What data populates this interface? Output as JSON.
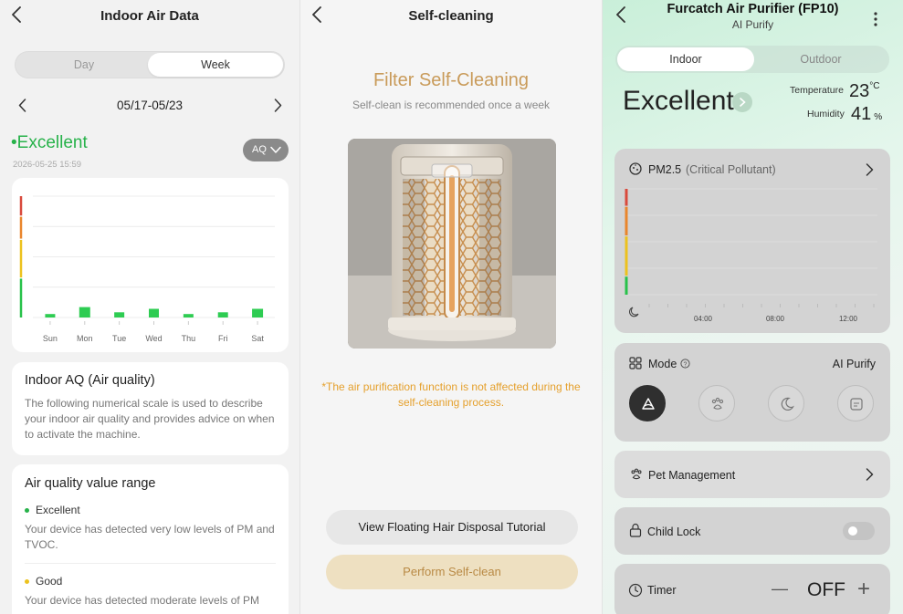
{
  "panel1": {
    "title": "Indoor Air Data",
    "tabs": [
      "Day",
      "Week"
    ],
    "active_tab": "Week",
    "date_range": "05/17-05/23",
    "status": "•Excellent",
    "timestamp": "2026-05-25 15:59",
    "aq_button": "AQ",
    "chart_data": {
      "type": "bar",
      "categories": [
        "Sun",
        "Mon",
        "Tue",
        "Wed",
        "Thu",
        "Fri",
        "Sat"
      ],
      "values": [
        1,
        3,
        1.5,
        2.5,
        1,
        1.5,
        2.5
      ],
      "ylim": [
        0,
        35
      ],
      "grid": true,
      "bar_color": "#2ecc52",
      "level_colors": [
        "#27c24a",
        "#ecc21e",
        "#e9862c",
        "#d94a3c"
      ]
    },
    "info_card": {
      "title": "Indoor AQ (Air quality)",
      "body": "The following numerical scale is used to describe your indoor air quality and provides advice on when to activate the machine."
    },
    "range_card": {
      "title": "Air quality value range",
      "items": [
        {
          "label": "Excellent",
          "color": "#27b24a",
          "desc": "Your device has detected very low levels of PM and TVOC."
        },
        {
          "label": "Good",
          "color": "#ecc21e",
          "desc": "Your device has detected moderate levels of PM"
        }
      ]
    }
  },
  "panel2": {
    "title": "Self-cleaning",
    "heading": "Filter Self-Cleaning",
    "subheading": "Self-clean is recommended once a week",
    "note": "*The air purification function is not affected during the self-cleaning process.",
    "tutorial_button": "View Floating Hair Disposal Tutorial",
    "perform_button": "Perform Self-clean"
  },
  "panel3": {
    "title": "Furcatch Air Purifier (FP10)",
    "subtitle": "AI Purify",
    "tabs": [
      "Indoor",
      "Outdoor"
    ],
    "active_tab": "Indoor",
    "status": "Excellent",
    "temperature_label": "Temperature",
    "temperature_value": "23",
    "temperature_unit": "°C",
    "humidity_label": "Humidity",
    "humidity_value": "41",
    "humidity_unit": "%",
    "pm_title": "PM2.5",
    "pm_note": "(Critical Pollutant)",
    "pm_chart": {
      "type": "line",
      "x_ticks": [
        "04:00",
        "08:00",
        "12:00"
      ],
      "level_colors": [
        "#27c24a",
        "#ecc21e",
        "#e9862c",
        "#d94a3c"
      ]
    },
    "mode_label": "Mode",
    "mode_value": "AI Purify",
    "modes": [
      "ai-purify-icon",
      "pet-icon",
      "sleep-icon",
      "manual-icon"
    ],
    "active_mode": "ai-purify-icon",
    "pet_management": "Pet Management",
    "child_lock": "Child Lock",
    "child_lock_on": false,
    "timer": "Timer",
    "timer_value": "OFF",
    "timer_minus": "—",
    "timer_plus": "+"
  }
}
